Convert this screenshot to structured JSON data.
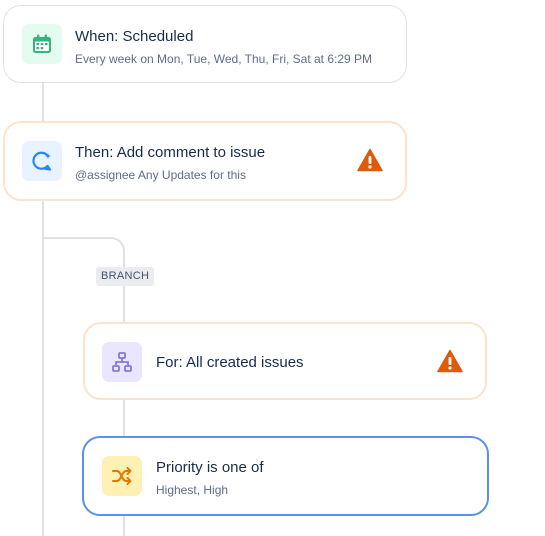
{
  "trigger": {
    "title": "When: Scheduled",
    "subtitle": "Every week on Mon, Tue, Wed, Thu, Fri, Sat at 6:29 PM",
    "icon": "calendar-icon"
  },
  "action": {
    "title": "Then: Add comment to issue",
    "subtitle": "@assignee Any Updates for this",
    "icon": "comment-add-icon",
    "status": "warning-icon"
  },
  "branch": {
    "label": "BRANCH",
    "title": "For: All created issues",
    "icon": "hierarchy-icon",
    "status": "warning-icon"
  },
  "condition": {
    "title": "Priority is one of",
    "subtitle": "Highest, High",
    "icon": "shuffle-icon"
  },
  "colors": {
    "accent_selected": "#5b8ff2",
    "warning": "#de5b0c",
    "trigger_icon_bg": "#e3fcef",
    "trigger_icon": "#36b37e",
    "action_icon_bg": "#e9f2ff",
    "action_icon": "#2684ff",
    "branch_icon_bg": "#eae6ff",
    "branch_icon": "#8777d9",
    "condition_icon_bg": "#fff0b3",
    "condition_icon": "#e07a00"
  }
}
